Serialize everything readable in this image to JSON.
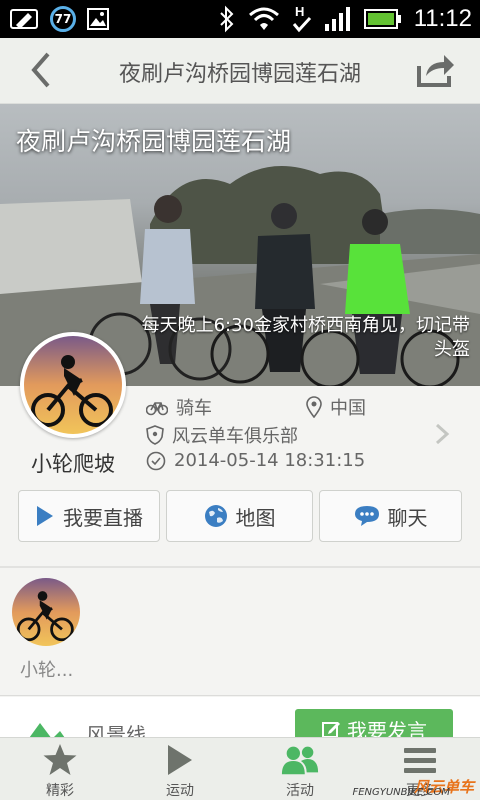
{
  "status_bar": {
    "badge": "77",
    "time": "11:12",
    "icons": [
      "sync-icon",
      "badge-77-icon",
      "picture-icon",
      "bluetooth-icon",
      "wifi-icon",
      "h-signal-icon",
      "signal-bars-icon",
      "battery-icon"
    ]
  },
  "header": {
    "title": "夜刷卢沟桥园博园莲石湖",
    "back_icon": "chevron-left-icon",
    "share_icon": "share-icon"
  },
  "hero": {
    "title": "夜刷卢沟桥园博园莲石湖",
    "description": "每天晚上6:30金家村桥西南角见，切记带头盔"
  },
  "organizer": {
    "name": "小轮爬坡",
    "activity_type": "骑车",
    "location": "中国",
    "club": "风云单车俱乐部",
    "datetime": "2014-05-14 18:31:15"
  },
  "actions": {
    "live": "我要直播",
    "map": "地图",
    "chat": "聊天"
  },
  "participants": [
    {
      "name": "小轮..."
    }
  ],
  "partial_row": {
    "label": "风景线",
    "post_button": "我要发言"
  },
  "bottom_nav": [
    {
      "label": "精彩",
      "icon": "star-icon"
    },
    {
      "label": "运动",
      "icon": "play-icon"
    },
    {
      "label": "活动",
      "icon": "people-icon"
    },
    {
      "label": "更多",
      "icon": "menu-icon"
    }
  ],
  "watermark": {
    "logo": "风云单车",
    "url": "FENGYUNBIKE.COM"
  },
  "colors": {
    "accent_green": "#5cb85c",
    "icon_blue": "#3b7ec2",
    "header_bg": "#eef0ec"
  }
}
